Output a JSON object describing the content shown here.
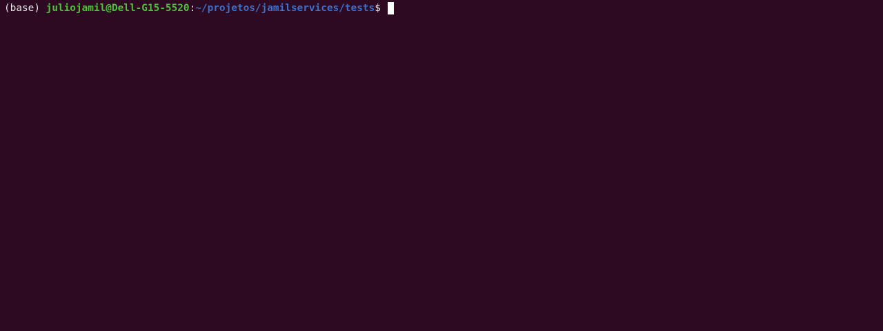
{
  "terminal": {
    "background": "#2d0922",
    "prompt": {
      "env": "(base) ",
      "userhost": "juliojamil@Dell-G15-5520",
      "colon": ":",
      "path": "~/projetos/jamilservices/tests",
      "symbol": "$ "
    },
    "colors": {
      "userhost": "#4ec23a",
      "path": "#3d6fc8",
      "text": "#e8e8e8",
      "cursor": "#ffffff"
    }
  }
}
